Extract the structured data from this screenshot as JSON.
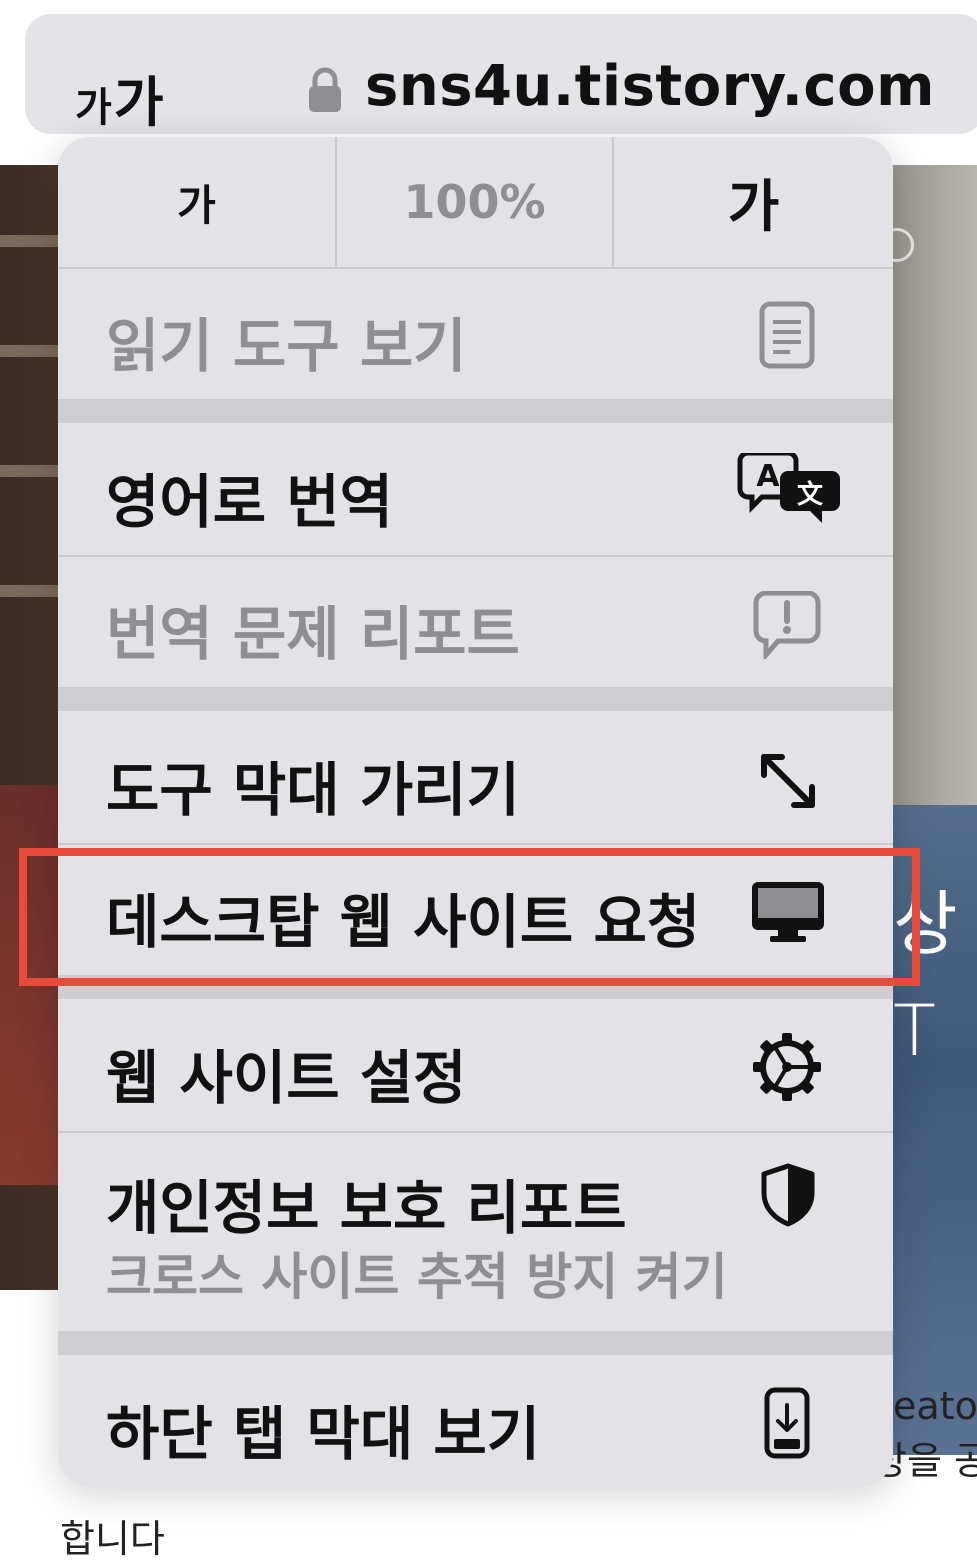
{
  "browser": {
    "text_size_button": {
      "small": "가",
      "large": "가"
    },
    "url": "sns4u.tistory.com"
  },
  "background_page": {
    "overlay_text_1": "상",
    "overlay_text_2": "T",
    "body_text_fragment_1": "eato",
    "body_text_fragment_2": "상을 공",
    "body_text_fragment_3": "합니다"
  },
  "menu": {
    "zoom": {
      "decrease_label": "가",
      "level": "100%",
      "increase_label": "가"
    },
    "items": [
      {
        "label": "읽기 도구 보기",
        "icon": "reader-icon",
        "enabled": false
      },
      {
        "label": "영어로 번역",
        "icon": "translate-icon",
        "enabled": true
      },
      {
        "label": "번역 문제 리포트",
        "icon": "report-bubble-icon",
        "enabled": false
      },
      {
        "label": "도구 막대 가리기",
        "icon": "expand-arrows-icon",
        "enabled": true
      },
      {
        "label": "데스크탑 웹 사이트 요청",
        "icon": "desktop-icon",
        "enabled": true,
        "highlighted": true
      },
      {
        "label": "웹 사이트 설정",
        "icon": "gear-icon",
        "enabled": true
      },
      {
        "label": "개인정보 보호 리포트",
        "sublabel": "크로스 사이트 추적 방지 켜기",
        "icon": "shield-icon",
        "enabled": true
      },
      {
        "label": "하단 탭 막대 보기",
        "icon": "phone-download-icon",
        "enabled": true
      }
    ]
  },
  "colors": {
    "highlight": "#e84a3c",
    "menu_background": "#e3e3e7",
    "disabled_text": "#8e8e93"
  }
}
